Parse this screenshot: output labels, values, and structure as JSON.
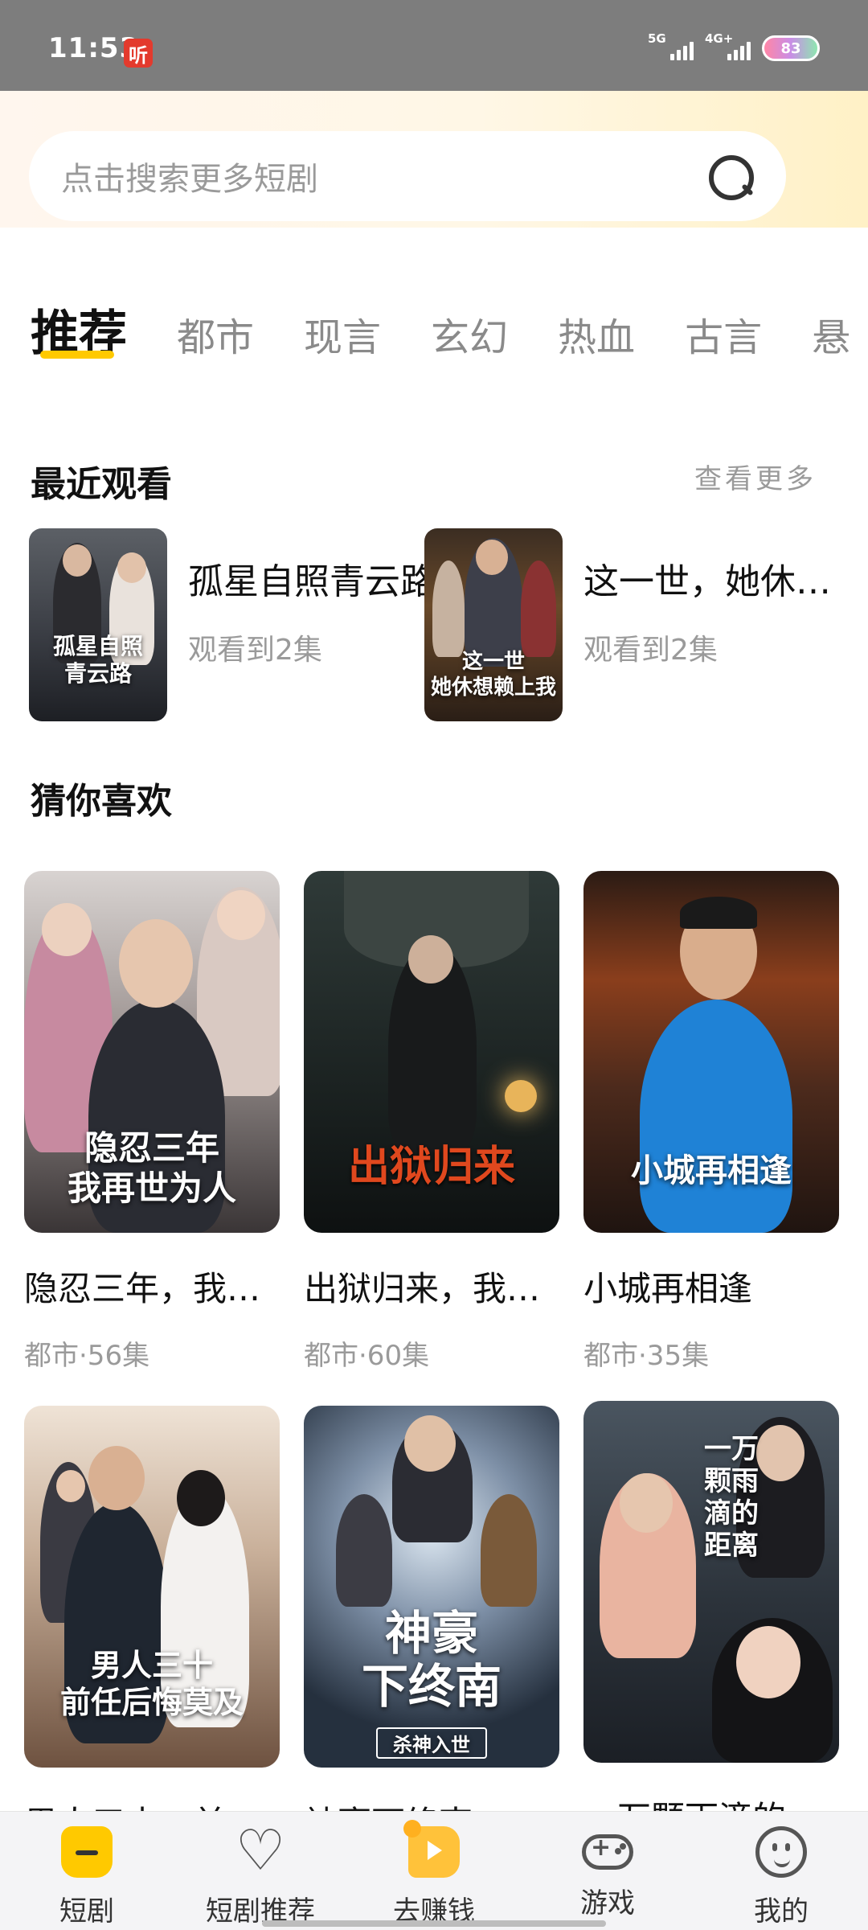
{
  "status_bar": {
    "time": "11:53",
    "app_badge": "听",
    "signal1": "5G",
    "signal2": "4G+",
    "battery": "83"
  },
  "search": {
    "placeholder": "点击搜索更多短剧"
  },
  "tabs": [
    "推荐",
    "都市",
    "现言",
    "玄幻",
    "热血",
    "古言",
    "悬"
  ],
  "recent": {
    "title": "最近观看",
    "see_more": "查看更多",
    "items": [
      {
        "title": "孤星自照青云路",
        "progress": "观看到2集",
        "poster_text": "孤星自照\n青云路"
      },
      {
        "title": "这一世，她休…",
        "progress": "观看到2集",
        "poster_text": "这一世\n她休想赖上我"
      }
    ]
  },
  "recommend": {
    "title": "猜你喜欢",
    "cards": [
      {
        "title": "隐忍三年，我…",
        "meta": "都市·56集",
        "poster_text": "隐忍三年\n我再世为人"
      },
      {
        "title": "出狱归来，我…",
        "meta": "都市·60集",
        "poster_text": "出狱归来"
      },
      {
        "title": "小城再相逢",
        "meta": "都市·35集",
        "poster_text": "小城再相逢"
      },
      {
        "title": "男人三十，前…",
        "meta": "",
        "poster_text": "男人三十\n前任后悔莫及"
      },
      {
        "title": "神豪下终南",
        "meta": "",
        "poster_text": "神豪\n下终南",
        "poster_sub": "杀神入世"
      },
      {
        "title": "一万颗雨滴的…",
        "meta": "",
        "poster_text": "一万颗雨滴的\n距离"
      }
    ]
  },
  "bottom_nav": [
    {
      "label": "短剧",
      "icon": "home-icon"
    },
    {
      "label": "短剧推荐",
      "icon": "heart-icon"
    },
    {
      "label": "去赚钱",
      "icon": "earn-icon"
    },
    {
      "label": "游戏",
      "icon": "gamepad-icon"
    },
    {
      "label": "我的",
      "icon": "profile-icon"
    }
  ],
  "colors": {
    "accent": "#ffc900",
    "status_bar": "#7d7d7d",
    "badge": "#e33a2d"
  }
}
